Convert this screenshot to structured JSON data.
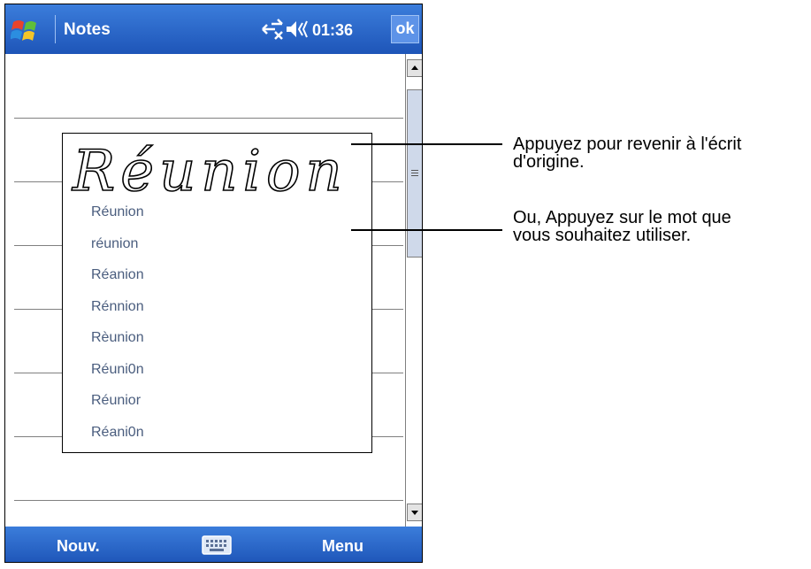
{
  "device": {
    "title": "Notes",
    "clock": "01:36",
    "ok_label": "ok",
    "icons": {
      "start": "windows-flag-icon",
      "connectivity": "connectivity-icon",
      "volume": "volume-icon",
      "keyboard": "keyboard-icon"
    }
  },
  "handwriting": {
    "text": "Réunion"
  },
  "candidates": [
    "Réunion",
    "réunion",
    "Réanion",
    "Rénnion",
    "Rèunion",
    "Réuni0n",
    "Réunior",
    "Réani0n"
  ],
  "bottom_bar": {
    "left_label": "Nouv.",
    "right_label": "Menu"
  },
  "annotations": [
    {
      "line1": "Appuyez pour revenir à l'écrit",
      "line2": "d'origine."
    },
    {
      "line1": "Ou, Appuyez sur le mot que",
      "line2": "vous souhaitez utiliser."
    }
  ],
  "colors": {
    "bar_top": "#3b7ddb",
    "bar_bottom": "#1e55b8",
    "candidate_text": "#4a5d7e"
  }
}
